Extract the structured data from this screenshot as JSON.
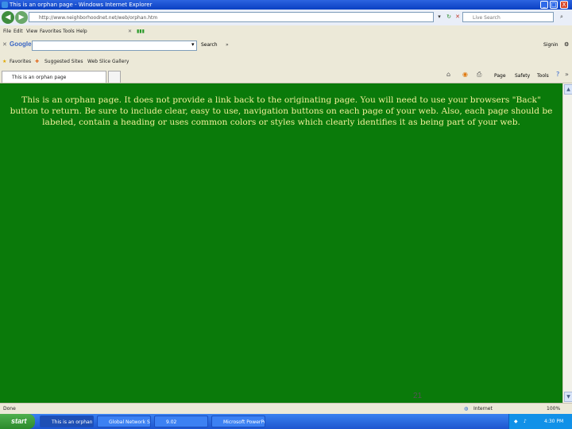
{
  "window": {
    "title": "This is an orphan page - Windows Internet Explorer",
    "controls": {
      "minimize": "_",
      "maximize": "□",
      "close": "X"
    }
  },
  "address_bar": {
    "url": "http://www.neighborhoodnet.net/web/orphan.htm",
    "search_placeholder": "Live Search"
  },
  "menu": [
    "File",
    "Edit",
    "View",
    "Favorites",
    "Tools",
    "Help"
  ],
  "google_bar": {
    "label": "Google",
    "search_btn": "Search",
    "bookmark": "Signin"
  },
  "favorites": {
    "label": "Favorites",
    "items": [
      "Suggested Sites",
      "Web Slice Gallery"
    ]
  },
  "tabs": [
    {
      "label": "This is an orphan page"
    }
  ],
  "page_tools": [
    "Page",
    "Safety",
    "Tools"
  ],
  "content": {
    "message": "This is an orphan page. It does not provide a link back to the originating page. You will need to use your browsers \"Back\" button to return. Be sure to include clear, easy to use, navigation buttons on each page of your web. Also, each page should be labeled, contain a heading or uses common colors or styles which clearly identifies it as being part of your web.",
    "page_number": "21",
    "background_color": "#0a7a0a",
    "text_color": "#f1ef9a"
  },
  "status_bar": {
    "left": "Done",
    "zone": "Internet",
    "zoom": "100%"
  },
  "taskbar": {
    "start": "start",
    "tasks": [
      "This is an orphan page",
      "Global Network Str...",
      "9.02",
      "Microsoft PowerPoint..."
    ],
    "clock": "4:30 PM"
  }
}
